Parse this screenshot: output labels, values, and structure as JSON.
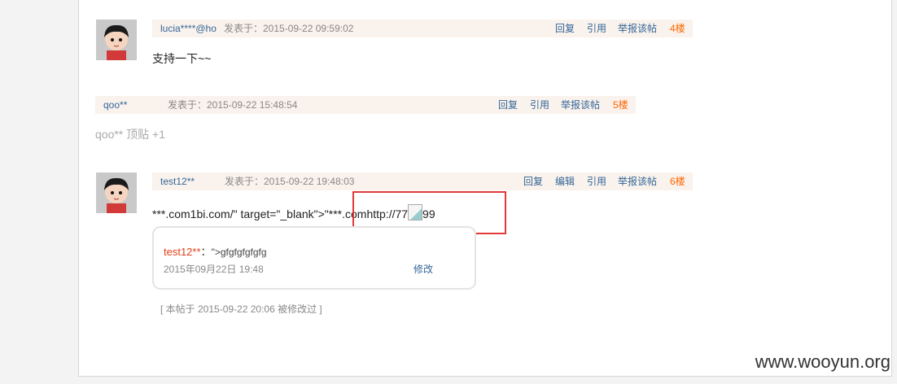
{
  "posts": [
    {
      "user": "lucia****@ho",
      "date": "发表于：2015-09-22 09:59:02",
      "actions": [
        "回复",
        "引用",
        "举报该帖"
      ],
      "floor": "4楼",
      "content": "支持一下~~"
    },
    {
      "user": "qoo**",
      "date": "发表于：2015-09-22 15:48:54",
      "actions": [
        "回复",
        "引用",
        "举报该帖"
      ],
      "floor": "5楼",
      "content": "qoo** 顶贴 +1"
    },
    {
      "user": "test12**",
      "date": "发表于：2015-09-22 19:48:03",
      "actions": [
        "回复",
        "编辑",
        "引用",
        "举报该帖"
      ],
      "floor": "6楼",
      "content_before": "***.com1bi.com/\" target=\"_blank\">\"***.comhttp://77",
      "content_after": "99",
      "comment": {
        "user": "test12**",
        "sep": "：",
        "text": "\">gfgfgfgfgfg",
        "date": "2015年09月22日 19:48",
        "edit": "修改"
      },
      "edited_note": "[ 本帖于 2015-09-22 20:06 被修改过 ]"
    }
  ],
  "watermark": "www.wooyun.org",
  "colors": {
    "bar_bg": "#faf2ec",
    "link": "#336699",
    "floor": "#ff6600",
    "highlight": "#e23a3a"
  }
}
